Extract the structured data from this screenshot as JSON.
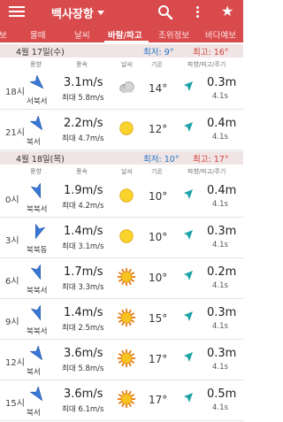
{
  "appbar": {
    "title": "백사장항"
  },
  "tabs": [
    "물때",
    "날씨",
    "바람/파고",
    "조위정보",
    "바다예보"
  ],
  "tab_left_fragment": "보",
  "columns": {
    "dir": "풍향",
    "speed": "풍속",
    "weather": "날씨",
    "temp": "기온",
    "wave": "파향/파고/주기"
  },
  "days": [
    {
      "date": "4월 17일(수)",
      "min": "최저: 9°",
      "max": "최고: 16°",
      "rows": [
        {
          "hour": "18시",
          "dir": "서북서",
          "speed": "3.1m/s",
          "max": "최대 5.8m/s",
          "wx": "cloud",
          "temp": "14°",
          "wave": "0.3m",
          "period": "4.1s"
        },
        {
          "hour": "21시",
          "dir": "북서",
          "speed": "2.2m/s",
          "max": "최대 4.7m/s",
          "wx": "sun",
          "temp": "12°",
          "wave": "0.4m",
          "period": "4.1s"
        }
      ]
    },
    {
      "date": "4월 18일(목)",
      "min": "최저: 10°",
      "max": "최고: 17°",
      "rows": [
        {
          "hour": "0시",
          "dir": "북북서",
          "speed": "1.9m/s",
          "max": "최대 4.2m/s",
          "wx": "sun",
          "temp": "10°",
          "wave": "0.4m",
          "period": "4.1s"
        },
        {
          "hour": "3시",
          "dir": "북북동",
          "speed": "1.4m/s",
          "max": "최대 3.1m/s",
          "wx": "sun",
          "temp": "10°",
          "wave": "0.3m",
          "period": "4.1s"
        },
        {
          "hour": "6시",
          "dir": "북북서",
          "speed": "1.7m/s",
          "max": "최대 3.3m/s",
          "wx": "sunhot",
          "temp": "10°",
          "wave": "0.2m",
          "period": "4.1s"
        },
        {
          "hour": "9시",
          "dir": "북북서",
          "speed": "1.4m/s",
          "max": "최대 2.5m/s",
          "wx": "sunhot",
          "temp": "15°",
          "wave": "0.3m",
          "period": "4.1s"
        },
        {
          "hour": "12시",
          "dir": "북서",
          "speed": "3.6m/s",
          "max": "최대 5.8m/s",
          "wx": "sunhot",
          "temp": "17°",
          "wave": "0.3m",
          "period": "4.1s"
        },
        {
          "hour": "15시",
          "dir": "북서",
          "speed": "3.6m/s",
          "max": "최대 6.1m/s",
          "wx": "sunhot",
          "temp": "17°",
          "wave": "0.5m",
          "period": "4.1s"
        }
      ]
    }
  ],
  "colors": {
    "appbar": "#d94a4d",
    "wind_arrow": "#3a78d8",
    "wave_arrow": "#1ea3a8",
    "min_temp": "#2472c8",
    "max_temp": "#d33c3c"
  }
}
